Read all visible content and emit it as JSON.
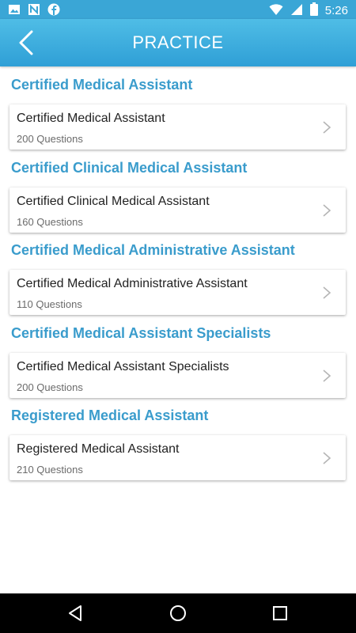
{
  "status_bar": {
    "time": "5:26",
    "left_icons": [
      "image-icon",
      "n-notification-icon",
      "facebook-icon"
    ],
    "right_icons": [
      "wifi-icon",
      "signal-icon",
      "battery-icon"
    ]
  },
  "header": {
    "title": "PRACTICE",
    "back_icon": "back-chevron-icon",
    "color": "#3aa6d6"
  },
  "sections": [
    {
      "heading": "Certified Medical Assistant",
      "card_title": "Certified Medical Assistant",
      "card_sub": "200 Questions"
    },
    {
      "heading": "Certified Clinical Medical Assistant",
      "card_title": "Certified Clinical Medical Assistant",
      "card_sub": "160 Questions"
    },
    {
      "heading": "Certified Medical Administrative Assistant",
      "card_title": "Certified Medical Administrative Assistant",
      "card_sub": "110 Questions"
    },
    {
      "heading": "Certified Medical Assistant Specialists",
      "card_title": "Certified Medical Assistant Specialists",
      "card_sub": "200 Questions"
    },
    {
      "heading": "Registered Medical Assistant",
      "card_title": "Registered Medical Assistant",
      "card_sub": "210 Questions"
    }
  ],
  "nav_bar": {
    "buttons": [
      "back-triangle-icon",
      "home-circle-icon",
      "recents-square-icon"
    ]
  },
  "colors": {
    "accent": "#3a9ccc",
    "header_gradient_top": "#4fbde6",
    "header_gradient_bottom": "#2f9fd6"
  }
}
